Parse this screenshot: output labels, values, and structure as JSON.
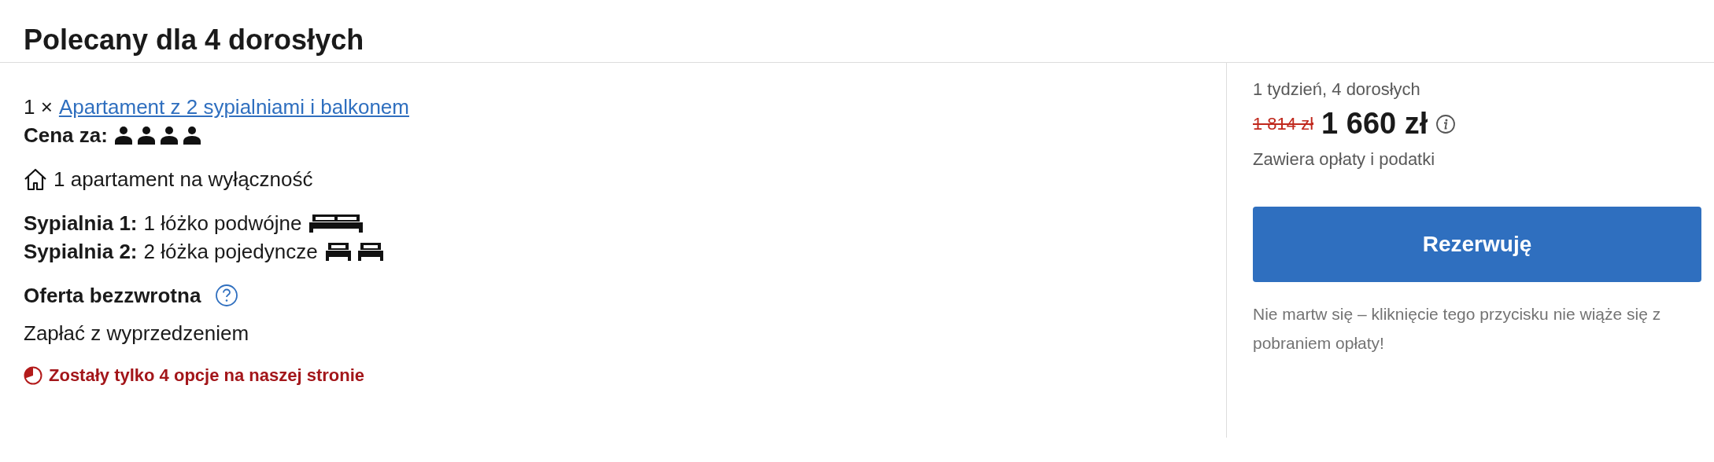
{
  "title": "Polecany dla 4 dorosłych",
  "unit": {
    "quantity": "1 ×",
    "name": "Apartament z 2 sypialniami i balkonem"
  },
  "price_for": {
    "label": "Cena za:",
    "guests": [
      {
        "kind": "adult"
      },
      {
        "kind": "adult"
      },
      {
        "kind": "adult"
      },
      {
        "kind": "adult"
      }
    ]
  },
  "exclusive": "1 apartament na wyłączność",
  "bedrooms": [
    {
      "name": "Sypialnia 1:",
      "beds": "1 łóżko podwójne",
      "icons": [
        {
          "kind": "double"
        }
      ]
    },
    {
      "name": "Sypialnia 2:",
      "beds": "2 łóżka pojedyncze",
      "icons": [
        {
          "kind": "single"
        },
        {
          "kind": "single"
        }
      ]
    }
  ],
  "policy": {
    "title": "Oferta bezzwrotna",
    "detail": "Zapłać z wyprzedzeniem"
  },
  "scarcity": "Zostały tylko 4 opcje na naszej stronie",
  "summary": {
    "stay": "1 tydzień, 4 dorosłych",
    "old_price": "1 814 zł",
    "price": "1 660 zł",
    "note": "Zawiera opłaty i podatki"
  },
  "reserve_button": "Rezerwuję",
  "reassurance": "Nie martw się – kliknięcie tego przycisku nie wiąże się z pobraniem opłaty!"
}
